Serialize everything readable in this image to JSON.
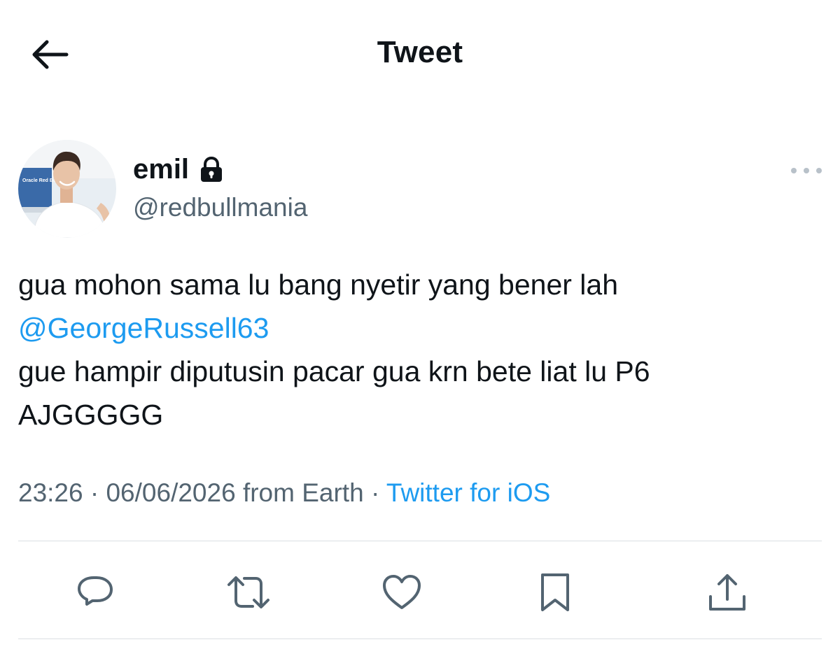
{
  "header": {
    "title": "Tweet",
    "back_icon": "arrow-left-icon"
  },
  "author": {
    "name": "emil",
    "handle": "@redbullmania",
    "protected_icon": "lock-icon",
    "avatar_banner_text": "Oracle Red Bull Racing"
  },
  "tweet": {
    "line1": "gua mohon sama lu bang nyetir yang bener lah",
    "mention": "@GeorgeRussell63",
    "line3": "gue hampir diputusin pacar gua krn bete liat lu P6",
    "line4": "AJGGGGG"
  },
  "meta": {
    "time": "23:26",
    "date": "06/06/2026",
    "location": "from Earth",
    "separator": "·",
    "source": "Twitter for iOS"
  },
  "actions": [
    {
      "name": "reply",
      "icon": "comment-icon"
    },
    {
      "name": "retweet",
      "icon": "retweet-icon"
    },
    {
      "name": "like",
      "icon": "heart-icon"
    },
    {
      "name": "bookmark",
      "icon": "bookmark-icon"
    },
    {
      "name": "share",
      "icon": "share-icon"
    }
  ],
  "colors": {
    "text": "#0f1419",
    "secondary": "#536471",
    "link": "#1d9bf0",
    "divider": "#dadfe3"
  }
}
